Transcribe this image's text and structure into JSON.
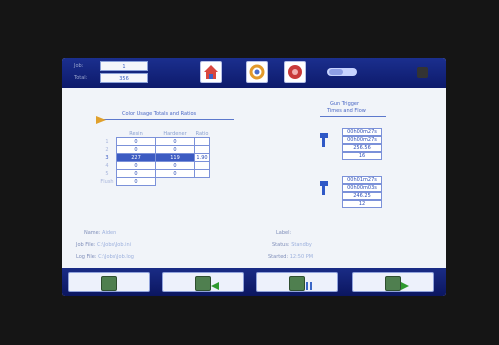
{
  "top": {
    "job_label": "Job:",
    "job_value": "1",
    "total_label": "Total:",
    "total_value": "356"
  },
  "toolbar": {
    "icons": [
      "home-icon",
      "recycle-icon",
      "record-icon"
    ],
    "toggle": "toggle",
    "lock_icon": "lock-icon"
  },
  "color_usage": {
    "title": "Color Usage Totals and Ratios",
    "headers": [
      "Resin",
      "Hardener",
      "Ratio"
    ],
    "rows": [
      {
        "label": "1",
        "resin": "0",
        "hardener": "0",
        "ratio": ""
      },
      {
        "label": "2",
        "resin": "0",
        "hardener": "0",
        "ratio": ""
      },
      {
        "label": "3",
        "resin": "227",
        "hardener": "119",
        "ratio": "1.90"
      },
      {
        "label": "4",
        "resin": "0",
        "hardener": "0",
        "ratio": ""
      },
      {
        "label": "5",
        "resin": "0",
        "hardener": "0",
        "ratio": ""
      },
      {
        "label": "Flush",
        "resin": "0",
        "hardener": "",
        "ratio": ""
      }
    ]
  },
  "gun_triggers": {
    "title_line1": "Gun Trigger",
    "title_line2": "Times and Flow",
    "gun1": {
      "values": [
        "00h00m27s",
        "00h00m27s",
        "256.56",
        "16"
      ]
    },
    "gun2": {
      "values": [
        "00h01m27s",
        "00h00m03s",
        "246.25",
        "12"
      ]
    }
  },
  "info": {
    "name_label": "Name:",
    "name_value": "Aiden",
    "jobfile_label": "Job File:",
    "jobfile_value": "C:\\Jobs\\Job.ini",
    "logfile_label": "Log File:",
    "logfile_value": "C:\\Jobs\\Job.log",
    "label_label": "Label:",
    "label_value": "",
    "status_label": "Status:",
    "status_value": "Standby",
    "started_label": "Started:",
    "started_value": "12:50 PM"
  },
  "bottom_buttons": [
    "button-1",
    "button-2",
    "button-3",
    "button-4"
  ],
  "colors": {
    "accent": "#3c5bc2",
    "bar": "#1b2f8e"
  }
}
